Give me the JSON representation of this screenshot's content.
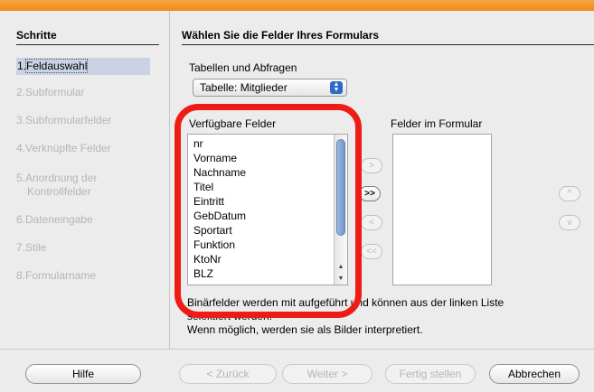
{
  "sidebar": {
    "title": "Schritte",
    "steps": [
      {
        "label": "1.Feldauswahl",
        "num": "1.",
        "text": "Feldauswahl"
      },
      {
        "label": "2.Subformular"
      },
      {
        "label": "3.Subformularfelder"
      },
      {
        "label": "4.Verknüpfte Felder"
      },
      {
        "label_line1": "5.Anordnung der",
        "label_line2": "Kontrollfelder"
      },
      {
        "label": "6.Dateneingabe"
      },
      {
        "label": "7.Stile"
      },
      {
        "label": "8.Formularname"
      }
    ]
  },
  "main": {
    "title": "Wählen Sie die Felder Ihres Formulars",
    "tables_label": "Tabellen und Abfragen",
    "table_select_value": "Tabelle: Mitglieder",
    "available_label": "Verfügbare Felder",
    "form_fields_label": "Felder im Formular",
    "available_fields": [
      "nr",
      "Vorname",
      "Nachname",
      "Titel",
      "Eintritt",
      "GebDatum",
      "Sportart",
      "Funktion",
      "KtoNr",
      "BLZ"
    ],
    "move_buttons": [
      ">",
      ">>",
      "<",
      "<<"
    ],
    "order_buttons": [
      "^",
      "v"
    ],
    "info_line1": "Binärfelder werden mit aufgeführt und können aus der linken Liste",
    "info_line2": "selektiert werden.",
    "info_line3": "Wenn möglich, werden sie als Bilder interpretiert."
  },
  "footer": {
    "help": "Hilfe",
    "back": "< Zurück",
    "next": "Weiter >",
    "finish": "Fertig stellen",
    "cancel": "Abbrechen"
  },
  "colors": {
    "accent_bar": "#ee8a17",
    "active_step_bg": "#c9d3e3",
    "highlight_ring": "#ee1c14"
  }
}
